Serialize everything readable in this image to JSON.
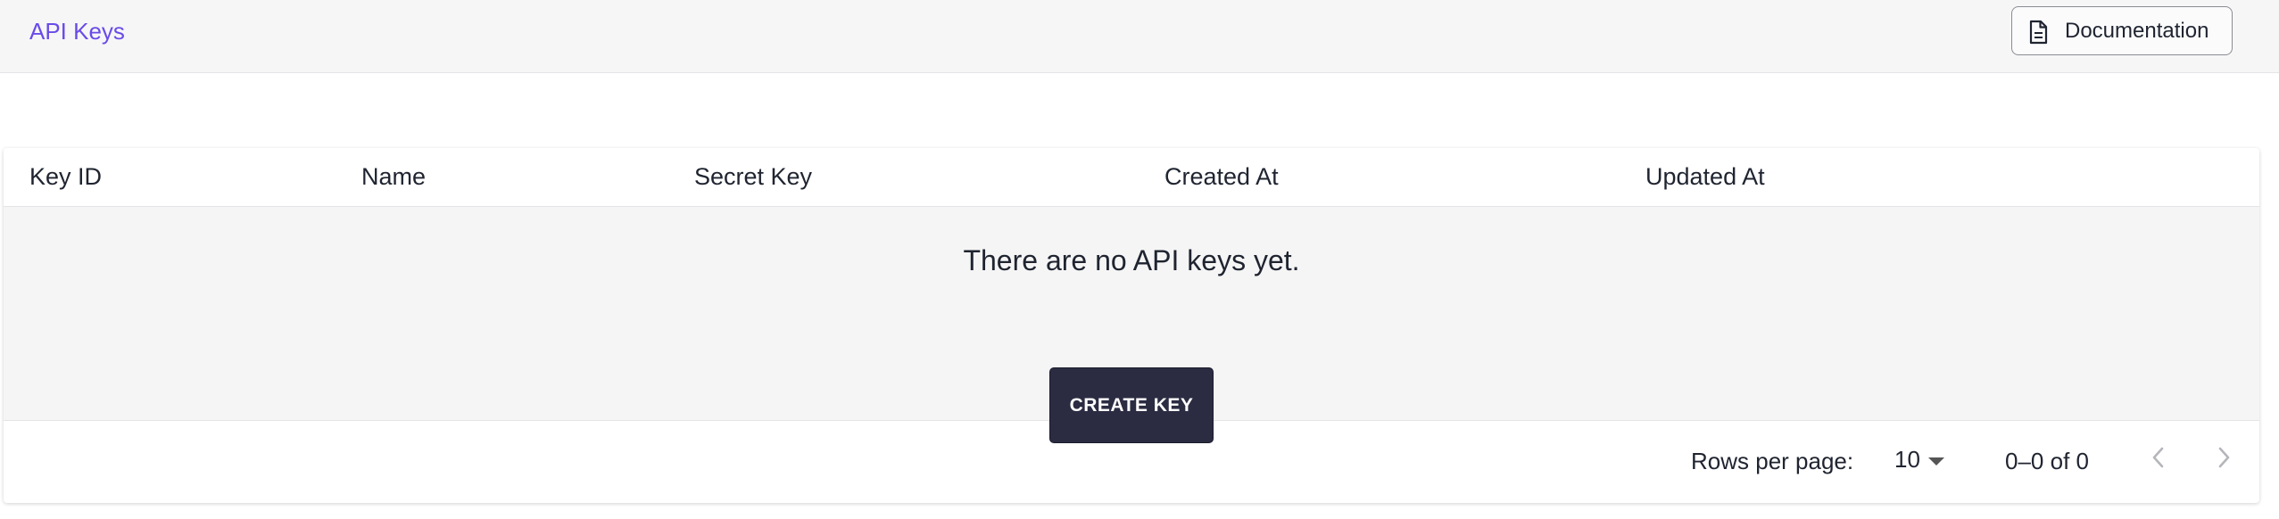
{
  "header": {
    "breadcrumb": "API Keys",
    "documentation_label": "Documentation",
    "documentation_icon": "document-icon",
    "accent_color": "#6a4be8"
  },
  "table": {
    "columns": [
      "Key ID",
      "Name",
      "Secret Key",
      "Created At",
      "Updated At"
    ],
    "rows": [],
    "empty_message": "There are no API keys yet.",
    "create_button_label": "CREATE KEY"
  },
  "pagination": {
    "rows_per_page_label": "Rows per page:",
    "rows_per_page_value": "10",
    "range_text": "0–0 of 0",
    "prev_icon": "chevron-left-icon",
    "next_icon": "chevron-right-icon"
  }
}
